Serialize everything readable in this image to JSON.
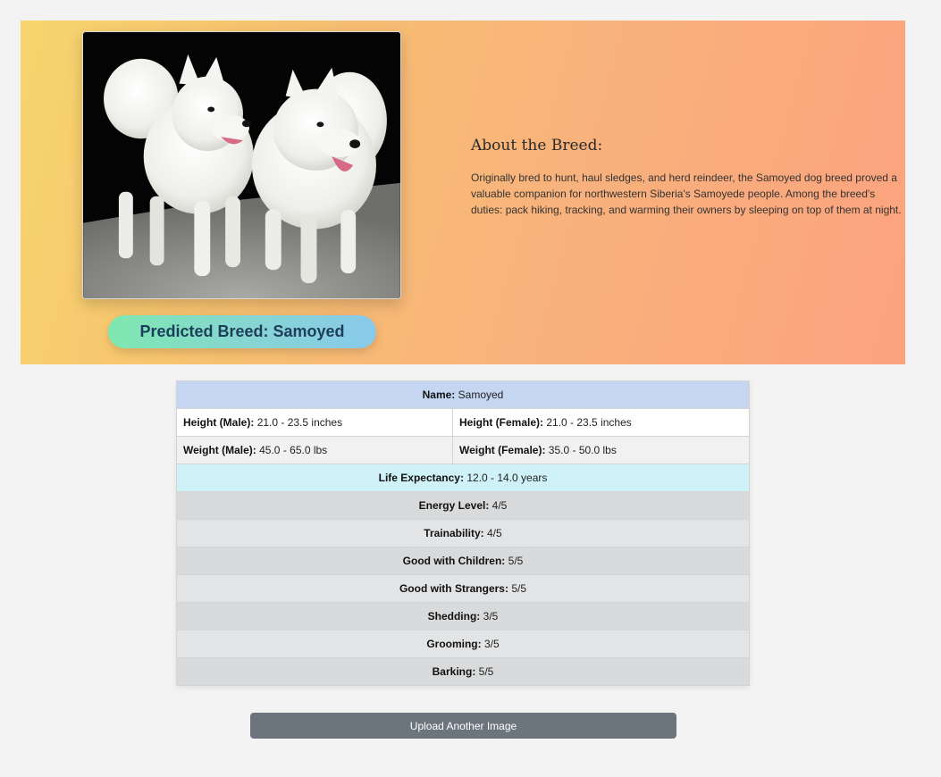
{
  "hero": {
    "predicted_prefix": "Predicted Breed:",
    "predicted_breed": "Samoyed",
    "about_title": "About the Breed:",
    "about_text": "Originally bred to hunt, haul sledges, and herd reindeer, the Samoyed dog breed proved a valuable companion for northwestern Siberia's Samoyede people. Among the breed's duties: pack hiking, tracking, and warming their owners by sleeping on top of them at night."
  },
  "table": {
    "name": {
      "label": "Name:",
      "value": "Samoyed"
    },
    "height_male": {
      "label": "Height (Male):",
      "value": "21.0 - 23.5 inches"
    },
    "height_female": {
      "label": "Height (Female):",
      "value": "21.0 - 23.5 inches"
    },
    "weight_male": {
      "label": "Weight (Male):",
      "value": "45.0 - 65.0 lbs"
    },
    "weight_female": {
      "label": "Weight (Female):",
      "value": "35.0 - 50.0 lbs"
    },
    "life": {
      "label": "Life Expectancy:",
      "value": "12.0 - 14.0 years"
    },
    "ratings": [
      {
        "label": "Energy Level:",
        "value": "4/5"
      },
      {
        "label": "Trainability:",
        "value": "4/5"
      },
      {
        "label": "Good with Children:",
        "value": "5/5"
      },
      {
        "label": "Good with Strangers:",
        "value": "5/5"
      },
      {
        "label": "Shedding:",
        "value": "3/5"
      },
      {
        "label": "Grooming:",
        "value": "3/5"
      },
      {
        "label": "Barking:",
        "value": "5/5"
      }
    ]
  },
  "upload_button_label": "Upload Another Image",
  "colors": {
    "hero_gradient_start": "#f7d56e",
    "hero_gradient_end": "#fca27e",
    "pill_gradient_start": "#7ee8b0",
    "pill_gradient_end": "#89c9ea",
    "button_bg": "#6c757d"
  }
}
